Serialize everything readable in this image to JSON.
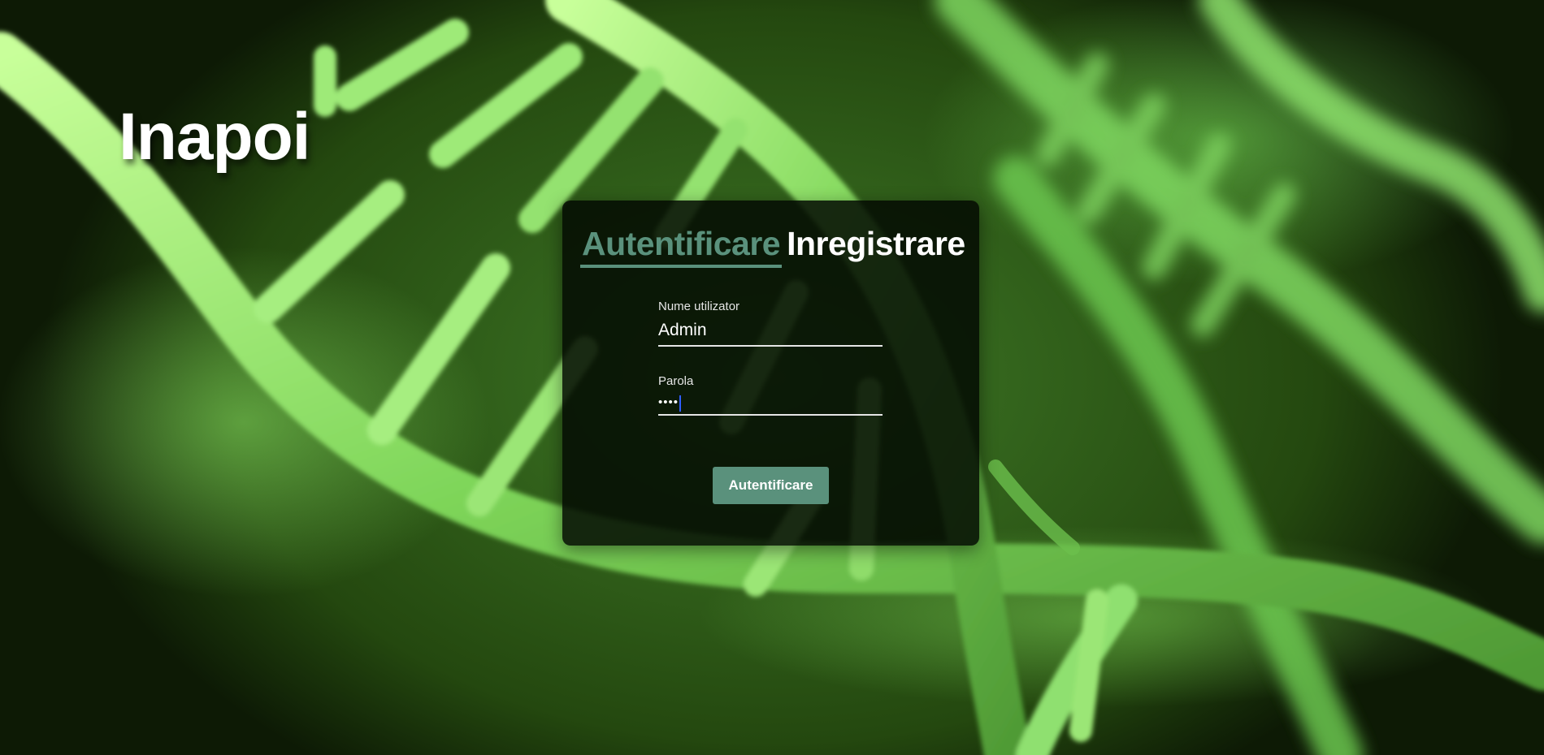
{
  "nav": {
    "back_label": "Inapoi"
  },
  "auth_card": {
    "tabs": [
      {
        "label": "Autentificare",
        "active": true
      },
      {
        "label": "Inregistrare",
        "active": false
      }
    ],
    "username": {
      "label": "Nume utilizator",
      "value": "Admin"
    },
    "password": {
      "label": "Parola",
      "value": "••••"
    },
    "submit_label": "Autentificare"
  },
  "colors": {
    "accent": "#5a917c",
    "card_background": "#040a02",
    "background_green": "#3f7a27"
  }
}
